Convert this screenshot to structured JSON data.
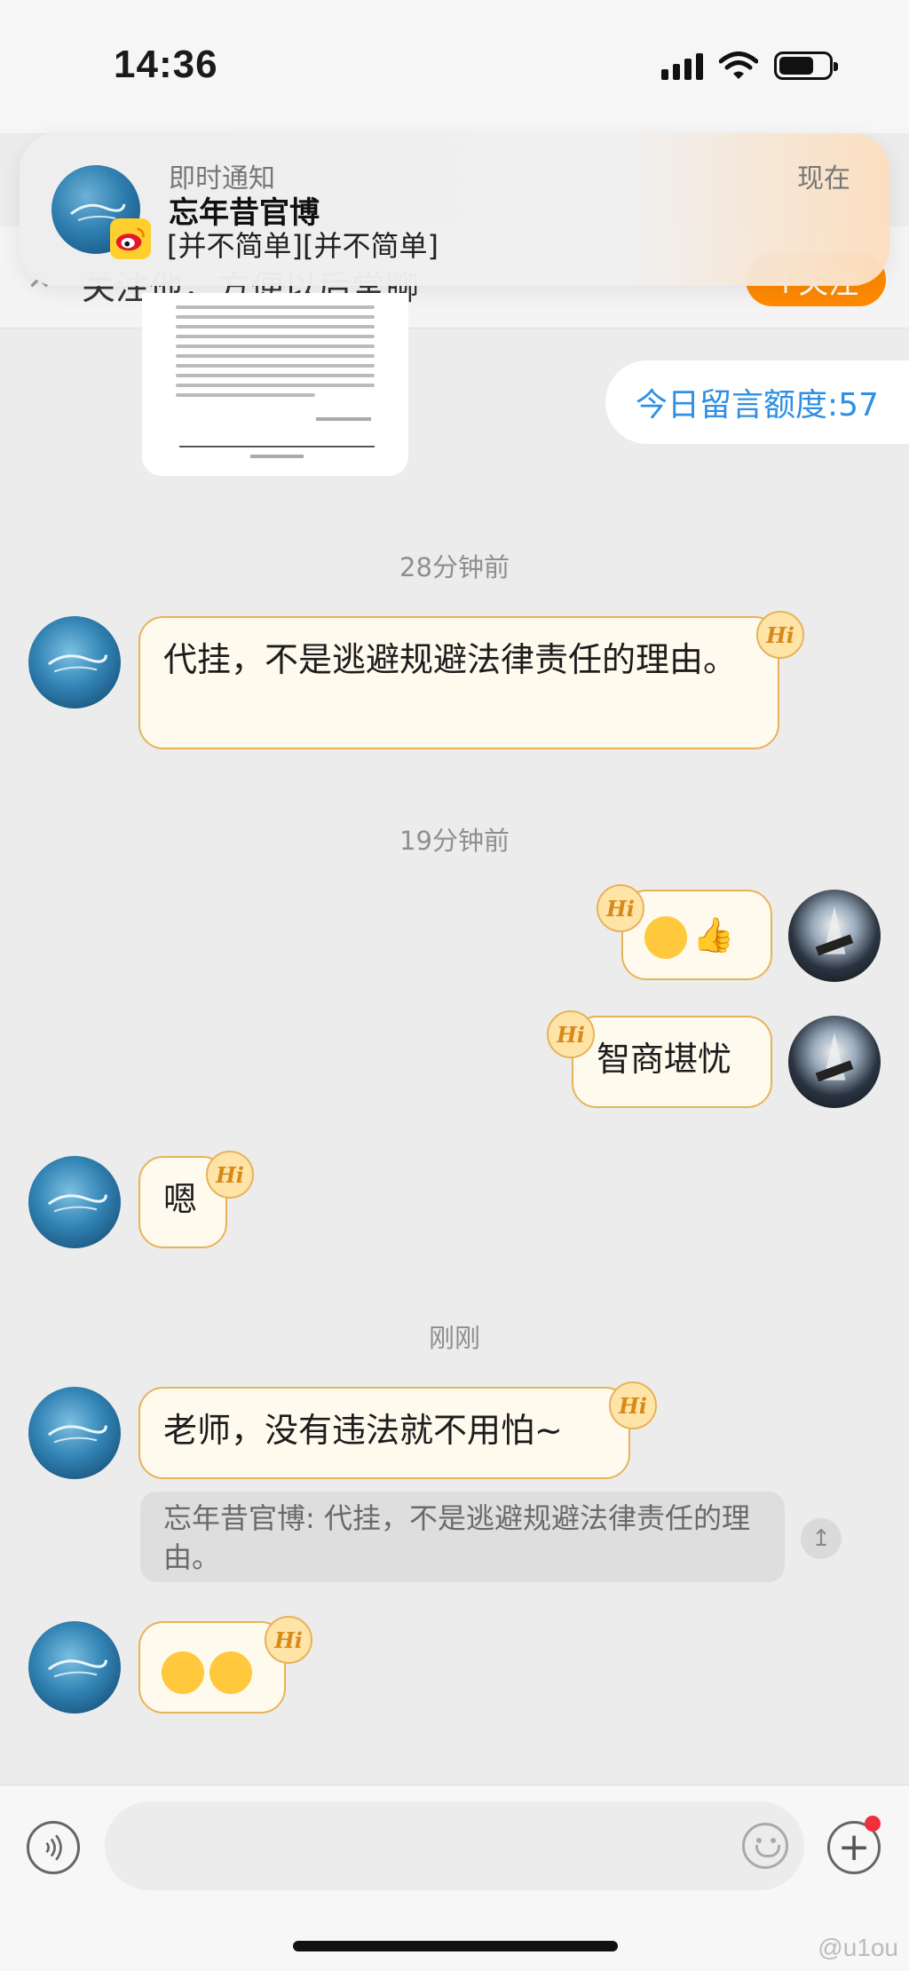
{
  "status_bar": {
    "time": "14:36"
  },
  "follow_bar": {
    "text": "关注他，方便以后常聊",
    "button": "+关注"
  },
  "notification": {
    "title": "即时通知",
    "sender": "忘年昔官博",
    "message": "[并不简单][并不简单]",
    "time": "现在"
  },
  "quota": {
    "label": "今日留言额度:57"
  },
  "messages": {
    "divider_1": "28分钟前",
    "msg_1": "代挂，不是逃避规避法律责任的理由。",
    "divider_2": "19分钟前",
    "msg_2_emoji": [
      "crying-laughing-emoji",
      "thumbs-up-emoji"
    ],
    "msg_3": "智商堪忧",
    "msg_4": "嗯",
    "divider_3": "刚刚",
    "msg_5": "老师，没有违法就不用怕~",
    "quote": "忘年昔官博: 代挂，不是逃避规避法律责任的理由。",
    "msg_6_emoji": [
      "shocked-glasses-emoji",
      "shocked-glasses-emoji"
    ],
    "hi_badge": "Hi"
  },
  "input": {
    "placeholder": ""
  },
  "watermark": "@u1ou",
  "colors": {
    "accent_orange": "#ff8a00",
    "quota_blue": "#2f8fe3",
    "bubble_border": "#e8b25a"
  }
}
